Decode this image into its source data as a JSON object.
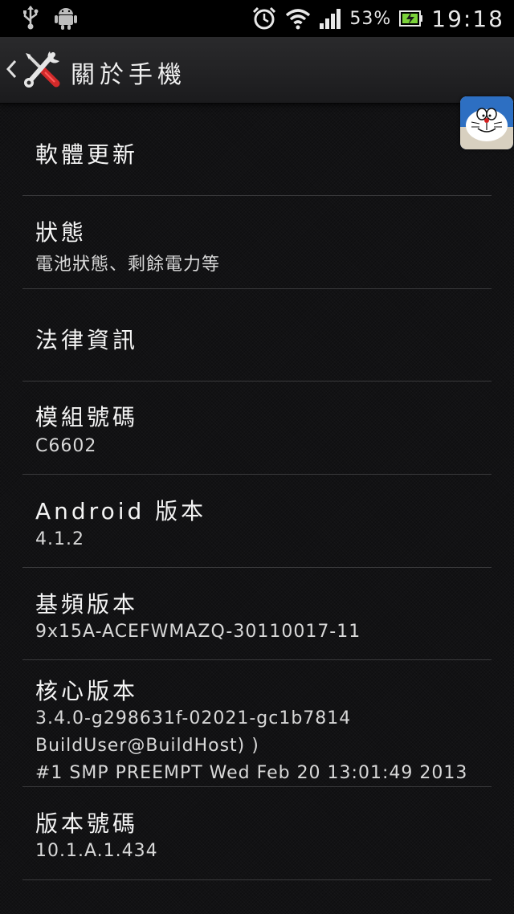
{
  "status_bar": {
    "icons_left": [
      "usb-icon",
      "android-debug-icon"
    ],
    "icons_right": [
      "alarm-icon",
      "wifi-icon",
      "signal-icon",
      "battery-charging-icon"
    ],
    "battery_percent": "53%",
    "time": "19:18"
  },
  "action_bar": {
    "title": "關於手機",
    "icon": "settings-tools-icon"
  },
  "settings": {
    "items": [
      {
        "title": "軟體更新"
      },
      {
        "title": "狀態",
        "subtitle": "電池狀態、剩餘電力等"
      },
      {
        "title": "法律資訊"
      },
      {
        "title": "模組號碼",
        "subtitle": "C6602"
      },
      {
        "title": "Android 版本",
        "subtitle": "4.1.2"
      },
      {
        "title": "基頻版本",
        "subtitle": "9x15A-ACEFWMAZQ-30110017-11"
      },
      {
        "title": "核心版本",
        "subtitle_lines": [
          "3.4.0-g298631f-02021-gc1b7814",
          "BuildUser@BuildHost) )",
          "#1 SMP PREEMPT Wed Feb 20 13:01:49 2013"
        ]
      },
      {
        "title": "版本號碼",
        "subtitle": "10.1.A.1.434"
      }
    ]
  },
  "colors": {
    "background": "#121214",
    "divider": "#3a3a3c",
    "text_primary": "#f4f4f4",
    "battery_accent": "#7bd23a"
  }
}
